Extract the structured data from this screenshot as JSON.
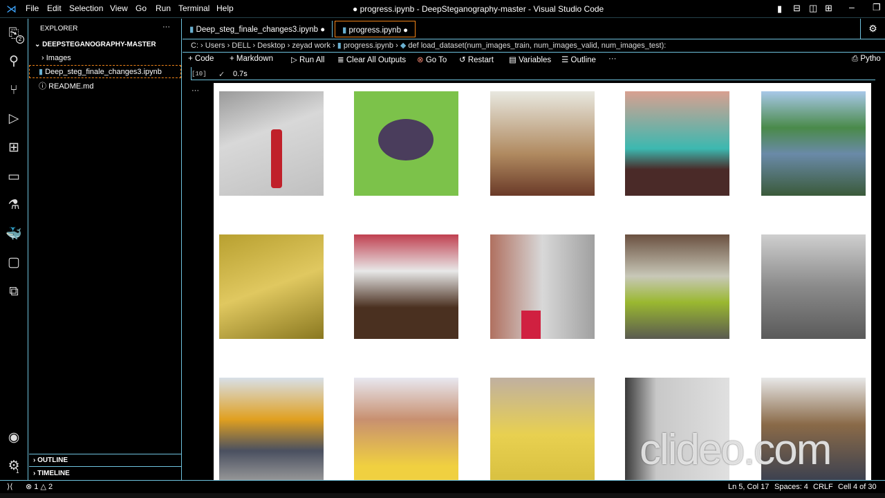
{
  "window": {
    "title": "● progress.ipynb - DeepSteganography-master - Visual Studio Code",
    "menu": [
      "File",
      "Edit",
      "Selection",
      "View",
      "Go",
      "Run",
      "Terminal",
      "Help"
    ]
  },
  "activity_badges": {
    "explorer": "2",
    "settings": "1"
  },
  "sidebar": {
    "header": "EXPLORER",
    "more": "···",
    "root": "DEEPSTEGANOGRAPHY-MASTER",
    "items": [
      "Images",
      "Deep_steg_finale_changes3.ipynb",
      "README.md"
    ],
    "outline": "OUTLINE",
    "timeline": "TIMELINE"
  },
  "tabs": [
    {
      "label": "Deep_steg_finale_changes3.ipynb",
      "dirty": "●"
    },
    {
      "label": "progress.ipynb",
      "dirty": "●"
    }
  ],
  "breadcrumb": [
    "C:",
    "Users",
    "DELL",
    "Desktop",
    "zeyad work",
    "progress.ipynb",
    "def load_dataset(num_images_train, num_images_valid, num_images_test):"
  ],
  "toolbar": {
    "code": "Code",
    "markdown": "Markdown",
    "run_all": "Run All",
    "clear": "Clear All Outputs",
    "goto": "Go To",
    "restart": "Restart",
    "variables": "Variables",
    "outline": "Outline",
    "more": "···",
    "kernel": "Pytho"
  },
  "cell": {
    "exec_count": "[10]",
    "check": "✓",
    "duration": "0.7s",
    "more": "···"
  },
  "watermark": "clideo.com",
  "status": {
    "errors": "1",
    "warnings": "2",
    "position": "Ln 5, Col 17",
    "spaces": "Spaces: 4",
    "eol": "CRLF",
    "cell": "Cell 4 of 30"
  }
}
